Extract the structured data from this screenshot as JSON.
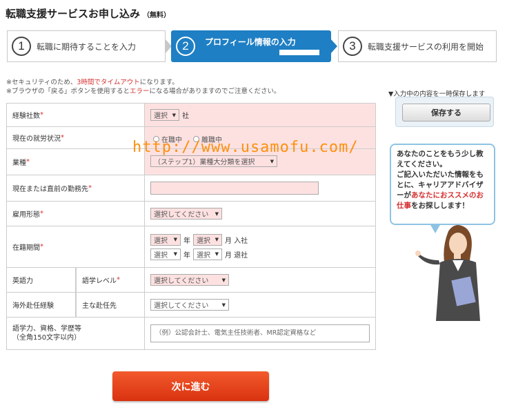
{
  "page": {
    "title": "転職支援サービスお申し込み",
    "title_sub": "（無料）"
  },
  "steps": [
    {
      "num": "1",
      "label": "転職に期待することを入力"
    },
    {
      "num": "2",
      "label": "プロフィール情報の入力"
    },
    {
      "num": "3",
      "label": "転職支援サービスの利用を開始"
    }
  ],
  "progress": {
    "step2_fill_percent": 35
  },
  "notes": {
    "line1_a": "※セキュリティのため、",
    "line1_b": "3時間でタイムアウト",
    "line1_c": "になります。",
    "line2_a": "※ブラウザの「戻る」ボタンを使用すると",
    "line2_b": "エラー",
    "line2_c": "になる場合がありますのでご注意ください。"
  },
  "form": {
    "experience": {
      "label": "経験社数",
      "req": "*",
      "select": "選択",
      "unit": "社"
    },
    "status": {
      "label": "現在の就労状況",
      "req": "*",
      "opt1": "在職中",
      "opt2": "離職中"
    },
    "industry": {
      "label": "業種",
      "req": "*",
      "select": "（ステップ1）業種大分類を選択"
    },
    "company": {
      "label": "現在または直前の勤務先",
      "req": "*"
    },
    "employment": {
      "label": "雇用形態",
      "req": "*",
      "select": "選択してください"
    },
    "period": {
      "label": "在籍期間",
      "req": "*",
      "select": "選択",
      "year": "年",
      "month_in": "月 入社",
      "month_out": "月 退社"
    },
    "english": {
      "label": "英語力",
      "sub_label": "語学レベル",
      "req": "*",
      "select": "選択してください"
    },
    "overseas": {
      "label": "海外赴任経験",
      "sub_label": "主な赴任先",
      "select": "選択してください"
    },
    "skills": {
      "label1": "語学力、資格、学歴等",
      "label2": "（全角150文字以内）",
      "placeholder": "（例）公認会計士、電気主任技術者、MR認定資格など"
    }
  },
  "submit_label": "次に進む",
  "save": {
    "note": "▼入力中の内容を一時保存します",
    "button": "保存する"
  },
  "bubble": {
    "l1": "あなたのことをもう少し教",
    "l2": "えてください。",
    "l3": "ご記入いただいた情報をも",
    "l4": "とに、キャリアアドバイザ",
    "l5a": "ーが",
    "l5b": "あなたにおススメのお",
    "l6a": "仕事",
    "l6b": "をお探しします！"
  },
  "watermark": "http://www.usamofu.com/",
  "colors": {
    "accent_blue": "#1f7fc4",
    "required_red": "#d63030",
    "submit_orange": "#e5431a",
    "field_pink": "#fde1e1"
  }
}
